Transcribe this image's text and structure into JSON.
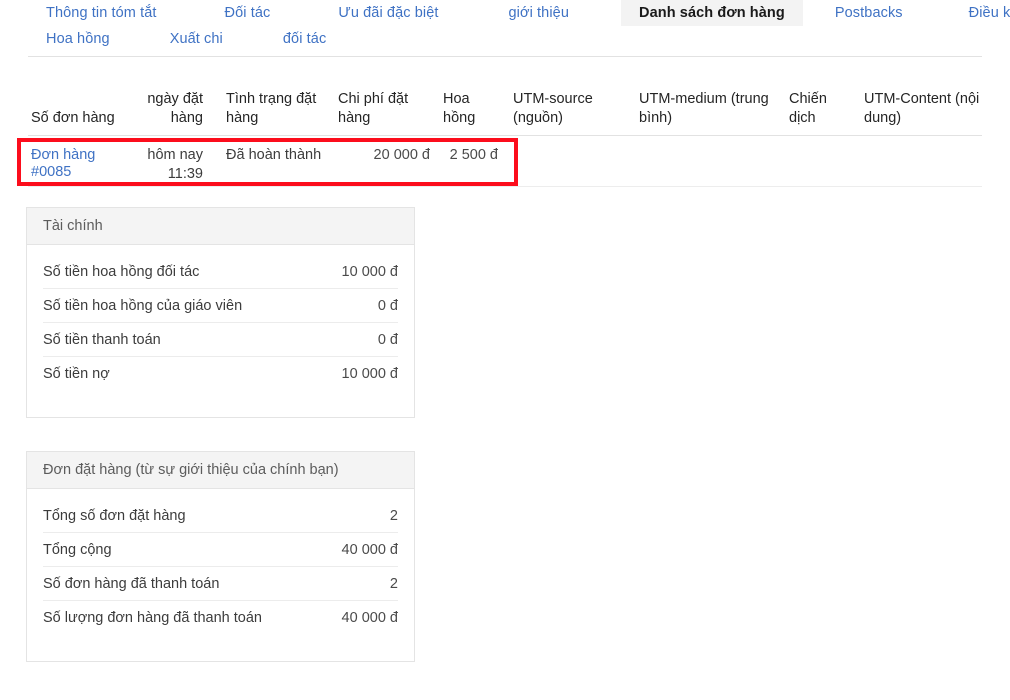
{
  "colors": {
    "link": "#3f72c4",
    "annotation_box": "#fc0d1c",
    "active_tab_bg": "#f3f3f3",
    "card_header_bg": "#f4f4f4",
    "border": "#e4e4e4"
  },
  "tabs": {
    "row1": [
      {
        "label": "Thông tin tóm tắt",
        "active": false
      },
      {
        "label": "Đối tác",
        "active": false
      },
      {
        "label": "Ưu đãi đặc biệt",
        "active": false
      },
      {
        "label": "giới thiệu",
        "active": false
      },
      {
        "label": "Danh sách đơn hàng",
        "active": true
      },
      {
        "label": "Postbacks",
        "active": false
      },
      {
        "label": "Điều kiện",
        "active": false
      }
    ],
    "row2": [
      {
        "label": "Hoa hồng",
        "active": false
      },
      {
        "label": "Xuất chi",
        "active": false
      },
      {
        "label": "đối tác",
        "active": false
      }
    ]
  },
  "orders_table": {
    "columns": [
      "Số đơn hàng",
      "ngày đặt hàng",
      "Tình trạng đặt hàng",
      "Chi phí đặt hàng",
      "Hoa hồng",
      "UTM-source (nguồn)",
      "UTM-medium (trung bình)",
      "Chiến dịch",
      "UTM-Content (nội dung)"
    ],
    "rows": [
      {
        "order_number": "Đơn hàng #0085",
        "order_date_day": "hôm nay",
        "order_date_time": "11:39",
        "status": "Đã hoàn thành",
        "order_cost": "20 000 đ",
        "commission": "2 500 đ",
        "utm_source": "",
        "utm_medium": "",
        "campaign": "",
        "utm_content": ""
      }
    ]
  },
  "cards": [
    {
      "title": "Tài chính",
      "rows": [
        {
          "label": "Số tiền hoa hồng đối tác",
          "value": "10 000 đ"
        },
        {
          "label": "Số tiền hoa hồng của giáo viên",
          "value": "0 đ"
        },
        {
          "label": "Số tiền thanh toán",
          "value": "0 đ"
        },
        {
          "label": "Số tiền nợ",
          "value": "10 000 đ"
        }
      ]
    },
    {
      "title": "Đơn đặt hàng (từ sự giới thiệu của chính bạn)",
      "rows": [
        {
          "label": "Tổng số đơn đặt hàng",
          "value": "2"
        },
        {
          "label": "Tổng cộng",
          "value": "40 000 đ"
        },
        {
          "label": "Số đơn hàng đã thanh toán",
          "value": "2"
        },
        {
          "label": "Số lượng đơn hàng đã thanh toán",
          "value": "40 000 đ"
        }
      ]
    }
  ]
}
